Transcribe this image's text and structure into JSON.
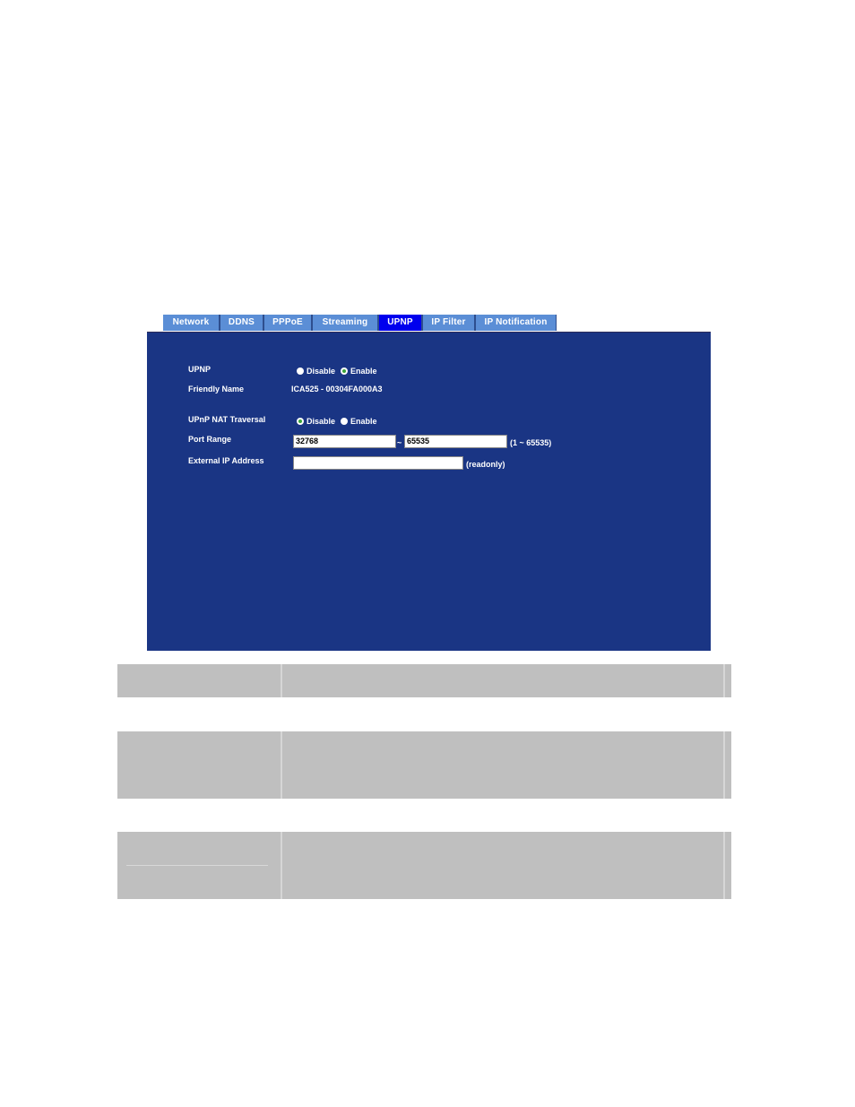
{
  "tabs": [
    {
      "label": "Network",
      "active": false
    },
    {
      "label": "DDNS",
      "active": false
    },
    {
      "label": "PPPoE",
      "active": false
    },
    {
      "label": "Streaming",
      "active": false
    },
    {
      "label": "UPNP",
      "active": true
    },
    {
      "label": "IP Filter",
      "active": false
    },
    {
      "label": "IP Notification",
      "active": false
    }
  ],
  "form": {
    "upnp": {
      "label": "UPNP",
      "options": [
        "Disable",
        "Enable"
      ],
      "selected": "Enable"
    },
    "friendly_name": {
      "label": "Friendly Name",
      "value": "ICA525 - 00304FA000A3"
    },
    "nat_traversal": {
      "label": "UPnP NAT Traversal",
      "options": [
        "Disable",
        "Enable"
      ],
      "selected": "Disable"
    },
    "port_range": {
      "label": "Port Range",
      "from": "32768",
      "separator": "~",
      "to": "65535",
      "hint": "(1 ~ 65535)"
    },
    "external_ip": {
      "label": "External IP Address",
      "value": "",
      "hint": "(readonly)"
    }
  },
  "colors": {
    "panel_bg": "#1a3584",
    "tab_bg": "#5b8ed6",
    "tab_active_bg": "#0000ee",
    "table_bg": "#bfbfbf"
  }
}
